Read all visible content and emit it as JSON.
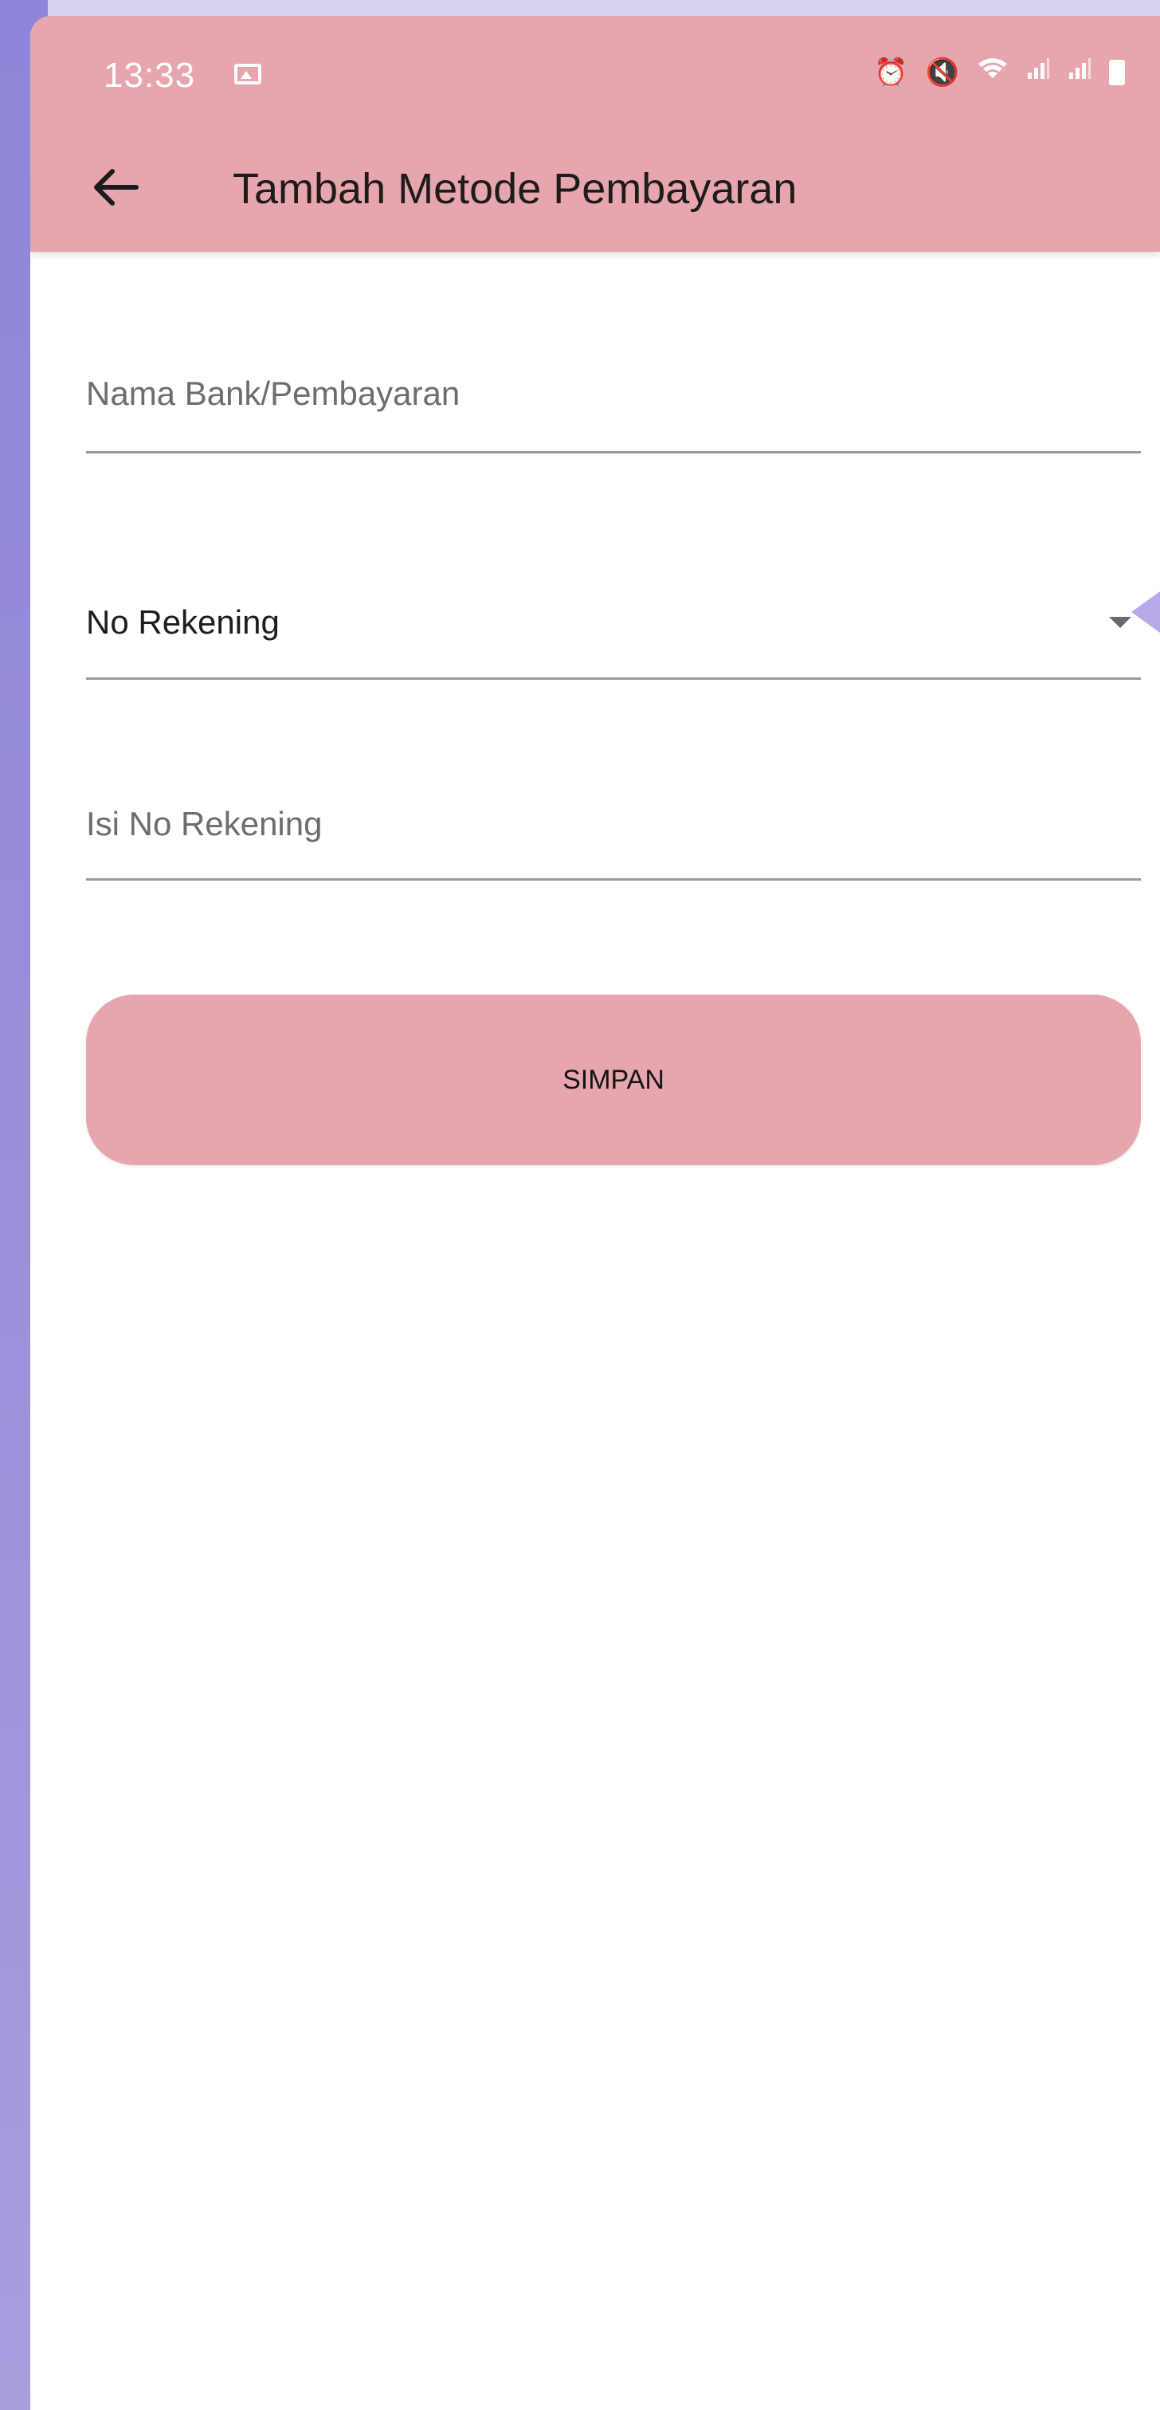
{
  "status_bar": {
    "time": "13:33",
    "icons": [
      "gallery-icon",
      "alarm-icon",
      "mute-icon",
      "wifi-icon",
      "signal-icon",
      "signal-icon",
      "battery-icon"
    ]
  },
  "appbar": {
    "title": "Tambah Metode Pembayaran",
    "back_icon": "arrow-left-icon",
    "background_color": "#e7a6ae"
  },
  "form": {
    "bank_field": {
      "placeholder": "Nama Bank/Pembayaran",
      "value": ""
    },
    "type_select": {
      "selected": "No Rekening"
    },
    "account_field": {
      "placeholder": "Isi No Rekening",
      "value": ""
    },
    "save_label": "SIMPAN"
  },
  "colors": {
    "accent": "#e7a6ae",
    "frame_purple": "#8e86d8"
  }
}
